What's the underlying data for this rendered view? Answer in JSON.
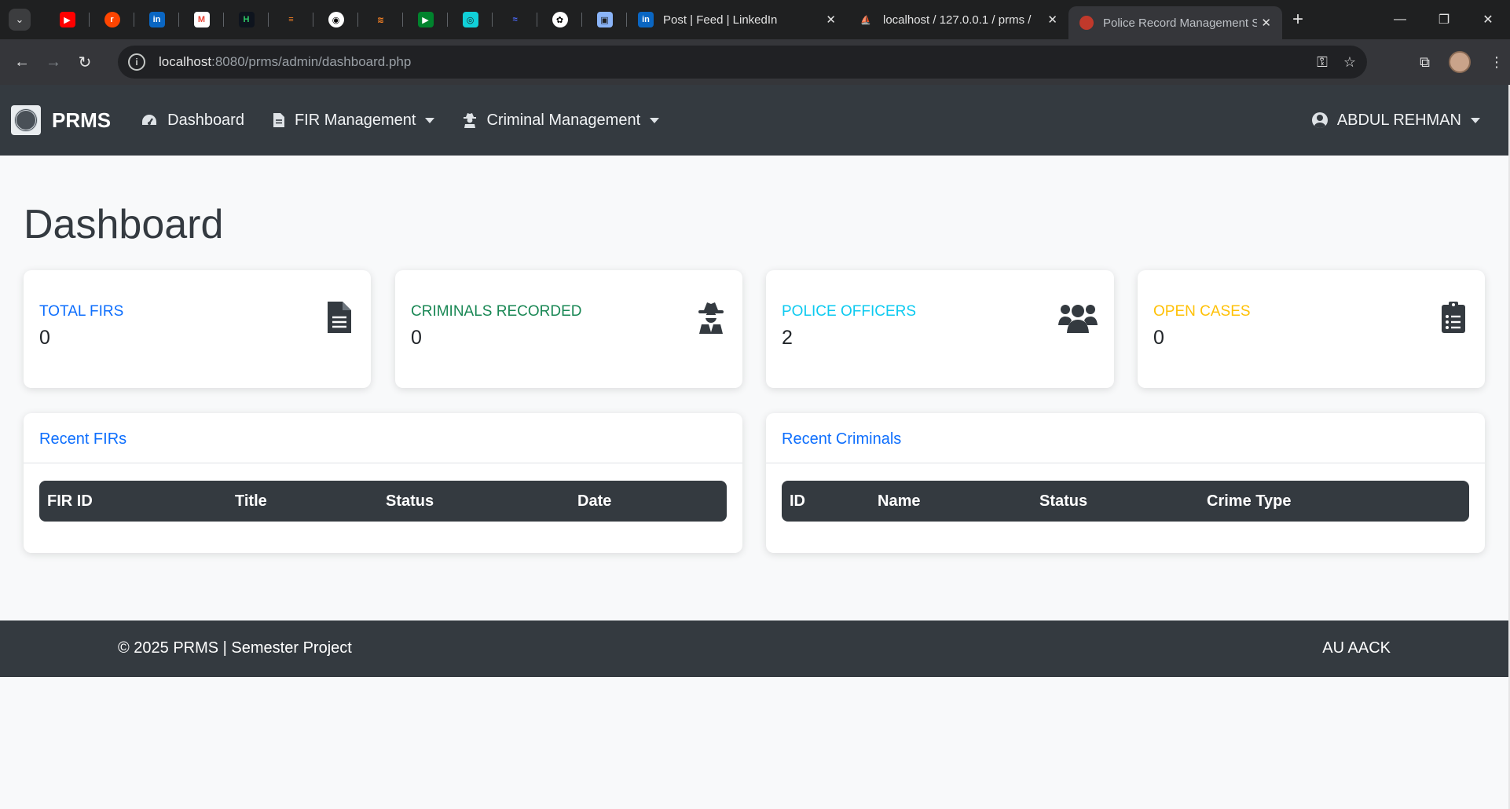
{
  "browser": {
    "pinned_tabs": [
      "youtube-icon",
      "reddit-icon",
      "linkedin-icon",
      "gmail-icon",
      "hackerrank-icon",
      "stackoverflow-icon",
      "github-icon",
      "stackoverflow-icon-2",
      "google-meet-icon",
      "chatgpt-alt-icon",
      "deepseek-icon",
      "openai-icon",
      "gift-icon"
    ],
    "tabs": [
      {
        "label": "Post | Feed | LinkedIn",
        "close": "✕"
      },
      {
        "label": "localhost / 127.0.0.1 / prms /",
        "close": "✕"
      },
      {
        "label": "Police Record Management S",
        "close": "✕"
      }
    ],
    "new_tab": "+",
    "url_host": "localhost",
    "url_rest": ":8080/prms/admin/dashboard.php"
  },
  "nav": {
    "brand": "PRMS",
    "links": [
      {
        "label": "Dashboard",
        "icon": "speedometer-icon"
      },
      {
        "label": "FIR Management",
        "icon": "file-icon"
      },
      {
        "label": "Criminal Management",
        "icon": "user-secret-icon"
      }
    ],
    "user": "ABDUL REHMAN"
  },
  "page": {
    "title": "Dashboard"
  },
  "stats": [
    {
      "label": "TOTAL FIRS",
      "value": "0",
      "color": "#0d6efd",
      "icon": "file-text-icon"
    },
    {
      "label": "CRIMINALS RECORDED",
      "value": "0",
      "color": "#198754",
      "icon": "user-secret-icon"
    },
    {
      "label": "POLICE OFFICERS",
      "value": "2",
      "color": "#0dcaf0",
      "icon": "users-icon"
    },
    {
      "label": "OPEN CASES",
      "value": "0",
      "color": "#ffc107",
      "icon": "clipboard-list-icon"
    }
  ],
  "panels": {
    "firs": {
      "title": "Recent FIRs",
      "columns": [
        "FIR ID",
        "Title",
        "Status",
        "Date"
      ]
    },
    "criminals": {
      "title": "Recent Criminals",
      "columns": [
        "ID",
        "Name",
        "Status",
        "Crime Type"
      ]
    }
  },
  "footer": {
    "left": "© 2025 PRMS | Semester Project",
    "right": "AU AACK"
  }
}
